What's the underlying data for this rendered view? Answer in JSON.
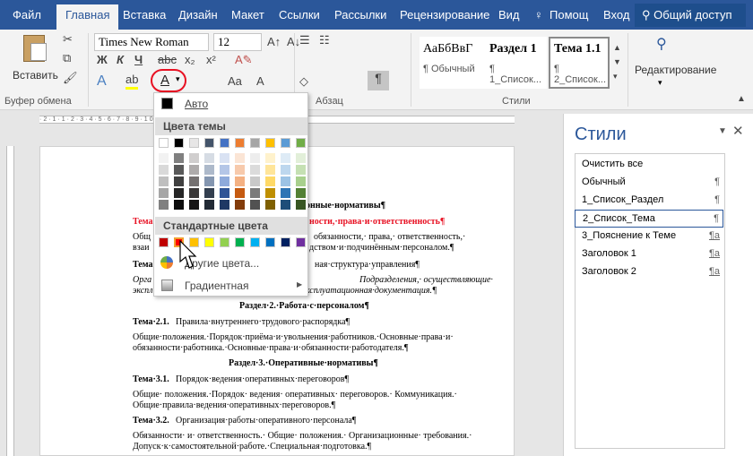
{
  "tabs": [
    "Файл",
    "Главная",
    "Вставка",
    "Дизайн",
    "Макет",
    "Ссылки",
    "Рассылки",
    "Рецензирование",
    "Вид",
    "Помощ",
    "Вход",
    "Общий доступ"
  ],
  "ribbon": {
    "paste_label": "Вставить",
    "clipboard_group": "Буфер обмена",
    "font_name": "Times New Roman",
    "font_size": "12",
    "bold": "Ж",
    "italic": "К",
    "underline": "Ч",
    "paragraph_group": "Абзац",
    "styles_group": "Стили",
    "editing_label": "Редактирование",
    "style_previews": [
      {
        "preview": "АаБбВвГ",
        "name": "¶ Обычный"
      },
      {
        "preview": "Раздел 1",
        "name": "¶ 1_Список..."
      },
      {
        "preview": "Тема 1.1",
        "name": "¶ 2_Список..."
      }
    ]
  },
  "colors": {
    "accent": "#2b579a",
    "highlight_red": "#e81123"
  },
  "dropdown": {
    "auto_label": "Авто",
    "theme_header": "Цвета темы",
    "standard_header": "Стандартные цвета",
    "more_colors": "Другие цвета...",
    "gradient": "Градиентная",
    "theme_top": [
      "#ffffff",
      "#000000",
      "#e7e6e6",
      "#44546a",
      "#4472c4",
      "#ed7d31",
      "#a5a5a5",
      "#ffc000",
      "#5b9bd5",
      "#70ad47"
    ],
    "theme_cols": [
      [
        "#f2f2f2",
        "#d9d9d9",
        "#bfbfbf",
        "#a6a6a6",
        "#808080"
      ],
      [
        "#808080",
        "#595959",
        "#404040",
        "#262626",
        "#0d0d0d"
      ],
      [
        "#d0cece",
        "#aeabab",
        "#757171",
        "#3a3838",
        "#171616"
      ],
      [
        "#d6dce4",
        "#adb9ca",
        "#8496b0",
        "#333f4f",
        "#222a35"
      ],
      [
        "#d9e2f3",
        "#b4c6e7",
        "#8eaadb",
        "#2f5496",
        "#1f3864"
      ],
      [
        "#fbe5d5",
        "#f7caac",
        "#f4b183",
        "#c55a11",
        "#833c0b"
      ],
      [
        "#ededed",
        "#dbdbdb",
        "#c9c9c9",
        "#7b7b7b",
        "#525252"
      ],
      [
        "#fff2cc",
        "#ffe599",
        "#ffd966",
        "#bf8f00",
        "#7f6000"
      ],
      [
        "#deebf6",
        "#bdd7ee",
        "#9cc3e5",
        "#2e75b5",
        "#1e4e79"
      ],
      [
        "#e2efd9",
        "#c5e0b3",
        "#a8d08d",
        "#538135",
        "#375623"
      ]
    ],
    "standard": [
      "#c00000",
      "#ff0000",
      "#ffc000",
      "#ffff00",
      "#92d050",
      "#00b050",
      "#00b0f0",
      "#0070c0",
      "#002060",
      "#7030a0"
    ]
  },
  "pane": {
    "title": "Стили",
    "items": [
      "Очистить все",
      "Обычный",
      "1_Список_Раздел",
      "2_Список_Тема",
      "3_Пояснение к Теме",
      "Заголовок 1",
      "Заголовок 2"
    ],
    "marks": [
      "",
      "¶",
      "¶",
      "¶",
      "¶a",
      "¶a",
      "¶a"
    ]
  },
  "document": {
    "lines": [
      "онные·нормативы¶",
      "Тема",
      "ности,·права·и·ответственность¶",
      "Общ",
      "обязанности,·   права,·   ответственность,·",
      "взаи",
      "дством·и·подчинённым·персоналом.¶",
      "Тема",
      "ная·структура·управления¶",
      "Орга",
      "Подразделения,·   осуществляющие·",
      "экспл",
      "ксплуатационная·документация.¶",
      "Раздел·2.·Работа·с·персоналом¶",
      "Тема·2.1.",
      "Правила·внутреннего·трудового·распорядка¶",
      "Общие·положения.·Порядок·приёма·и·увольнения·работников.·Основные·права·и·",
      "обязанности·работника.·Основные·права·и·обязанности·работодателя.¶",
      "Раздел·3.·Оперативные·нормативы¶",
      "Тема·3.1.",
      "Порядок·ведения·оперативных·переговоров¶",
      "Общие·   положения.·Порядок·   ведения·   оперативных·   переговоров.·   Коммуникация.·",
      "Общие·правила·ведения·оперативных·переговоров.¶",
      "Тема·3.2.",
      "Организация·работы·оперативного·персонала¶",
      "Обязанности·   и·   ответственность.·   Общие·   положения.·   Организационные·   требования.·",
      "Допуск·к·самостоятельной·работе.·Специальная·подготовка.¶"
    ]
  }
}
